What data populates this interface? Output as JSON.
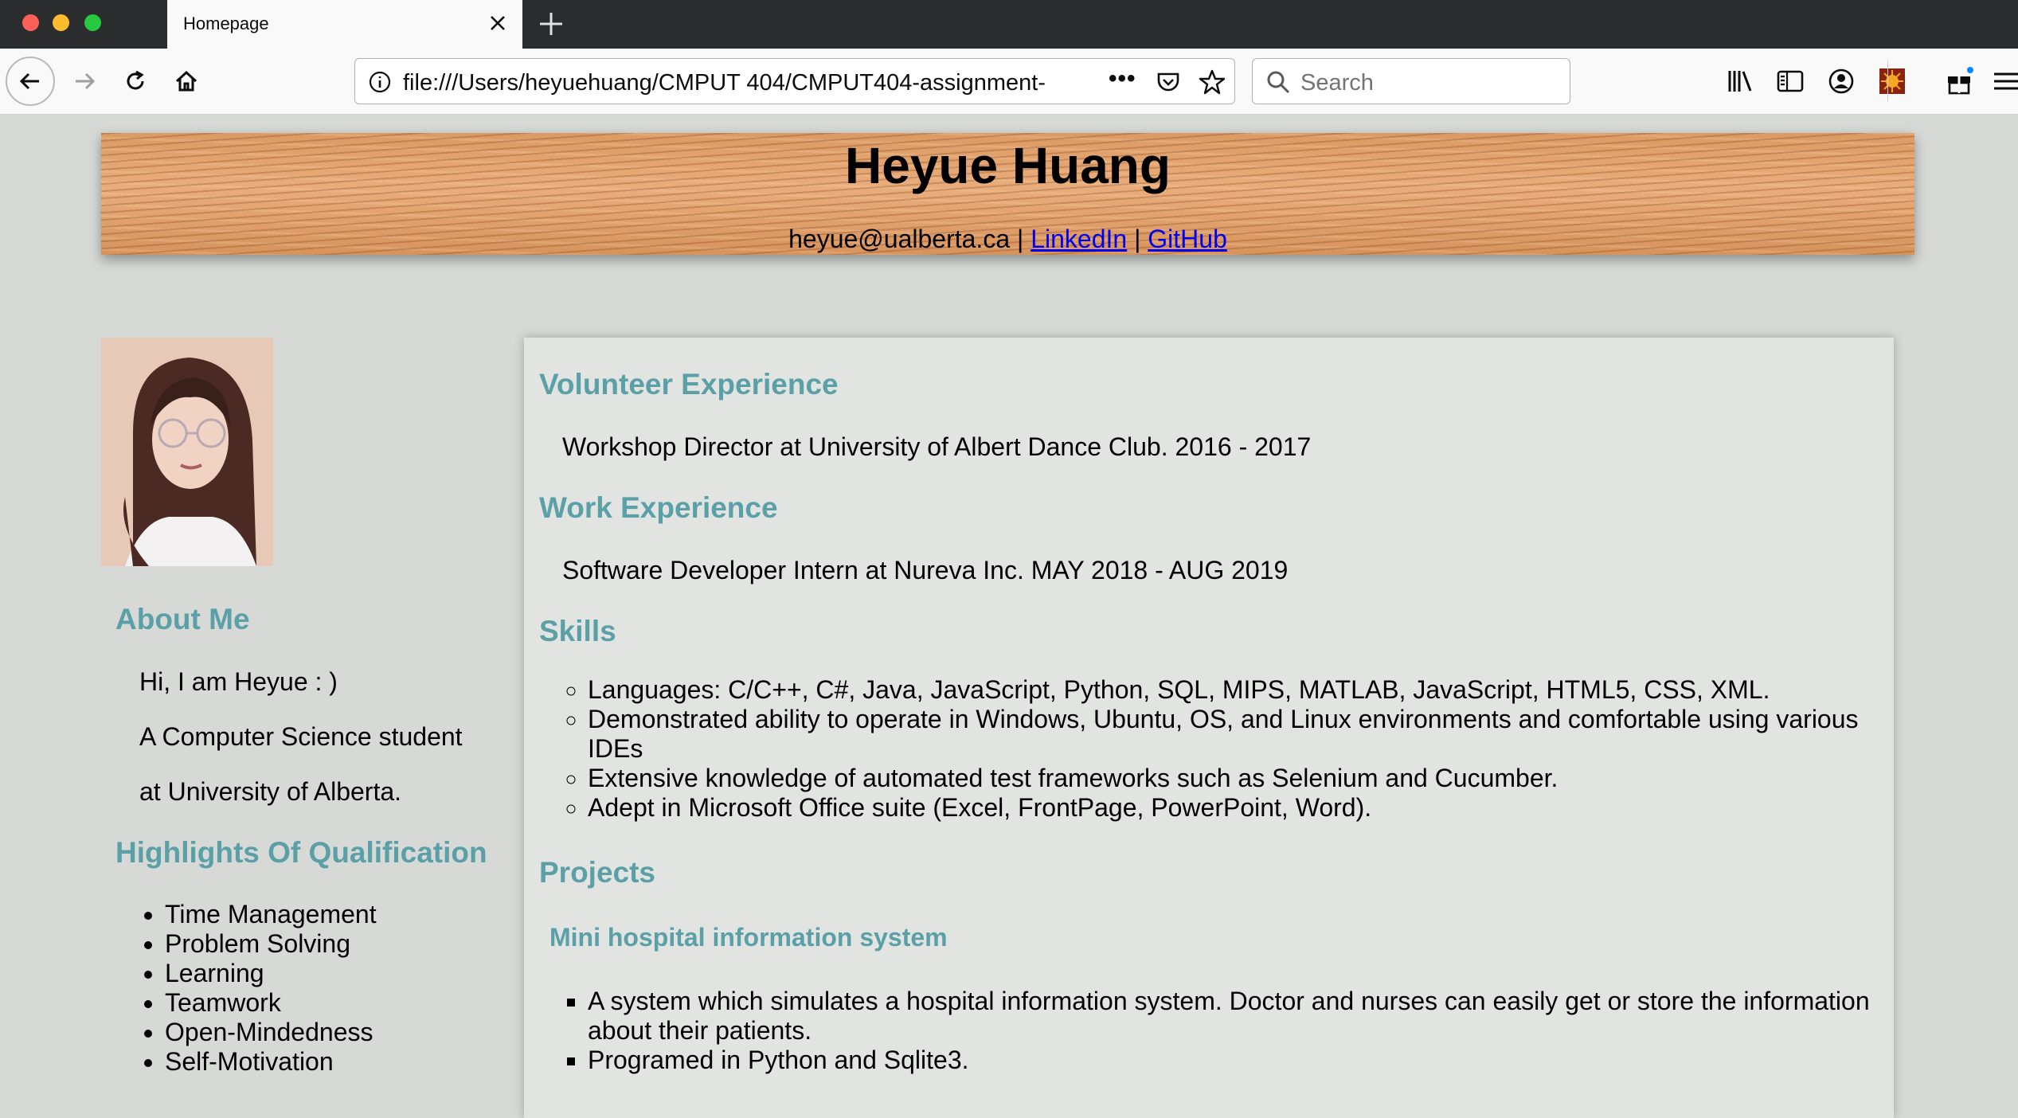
{
  "browser": {
    "tab_title": "Homepage",
    "url": "file:///Users/heyuehuang/CMPUT 404/CMPUT404-assignment-",
    "search_placeholder": "Search",
    "page_actions_label": "•••"
  },
  "header": {
    "name": "Heyue Huang",
    "email": "heyue@ualberta.ca",
    "separator": "|",
    "linkedin_label": "LinkedIn",
    "github_label": "GitHub"
  },
  "sidebar": {
    "about_title": "About Me",
    "about_lines": [
      "Hi, I am Heyue : )",
      "A Computer Science student",
      "at University of Alberta."
    ],
    "highlights_title": "Highlights Of Qualification",
    "highlights": [
      "Time Management",
      "Problem Solving",
      "Learning",
      "Teamwork",
      "Open-Mindedness",
      "Self-Motivation"
    ]
  },
  "main": {
    "volunteer_title": "Volunteer Experience",
    "volunteer_text": "Workshop Director at University of Albert Dance Club. 2016 - 2017",
    "work_title": "Work Experience",
    "work_text": "Software Developer Intern at Nureva Inc. MAY 2018 - AUG 2019",
    "skills_title": "Skills",
    "skills": [
      "Languages: C/C++, C#, Java, JavaScript, Python, SQL, MIPS, MATLAB, JavaScript, HTML5, CSS, XML.",
      "Demonstrated ability to operate in Windows, Ubuntu, OS, and Linux environments and comfortable using various IDEs",
      "Extensive knowledge of automated test frameworks such as Selenium and Cucumber.",
      "Adept in Microsoft Office suite (Excel, FrontPage, PowerPoint, Word)."
    ],
    "projects_title": "Projects",
    "project1_title": "Mini hospital information system",
    "project1_items": [
      "A system which simulates a hospital information system. Doctor and nurses can easily get or store the information about their patients.",
      "Programed in Python and Sqlite3."
    ]
  }
}
